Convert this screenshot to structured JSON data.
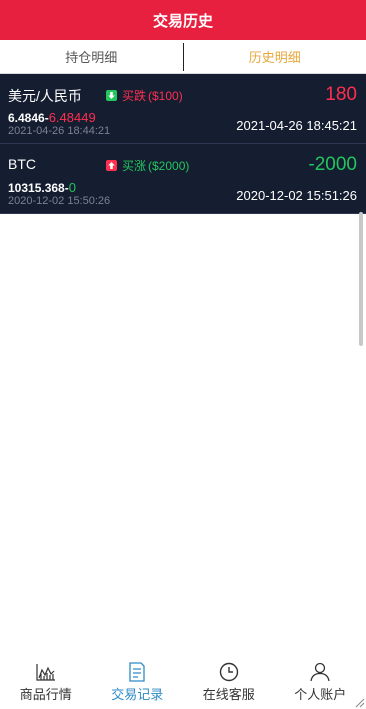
{
  "header": {
    "title": "交易历史"
  },
  "tabs": [
    {
      "label": "持仓明细",
      "active": false
    },
    {
      "label": "历史明细",
      "active": true
    }
  ],
  "records": [
    {
      "name": "美元/人民币",
      "direction_icon": "arrow-down-icon",
      "direction_label": "买跌",
      "amount": "($100)",
      "open_price": "6.4846",
      "separator": "-",
      "close_price": "6.48449",
      "close_price_color": "#ff2f4f",
      "open_time": "2021-04-26 18:44:21",
      "profit": "180",
      "profit_color": "#ff2f4f",
      "close_time": "2021-04-26 18:45:21",
      "badge_color": "#22c55e",
      "label_color": "#ff2f4f"
    },
    {
      "name": "BTC",
      "direction_icon": "arrow-up-icon",
      "direction_label": "买涨",
      "amount": "($2000)",
      "open_price": "10315.368",
      "separator": "-",
      "close_price": "0",
      "close_price_color": "#22c55e",
      "open_time": "2020-12-02 15:50:26",
      "profit": "-2000",
      "profit_color": "#22c55e",
      "close_time": "2020-12-02 15:51:26",
      "badge_color": "#ff2f4f",
      "label_color": "#22c55e"
    }
  ],
  "bottom_nav": [
    {
      "label": "商品行情",
      "icon": "chart-icon",
      "active": false
    },
    {
      "label": "交易记录",
      "icon": "document-icon",
      "active": true
    },
    {
      "label": "在线客服",
      "icon": "clock-icon",
      "active": false
    },
    {
      "label": "个人账户",
      "icon": "user-icon",
      "active": false
    }
  ],
  "colors": {
    "header": "#e8203f",
    "row_bg": "#151d30",
    "active_tab": "#e6a63a",
    "active_nav": "#2e8bc7"
  }
}
